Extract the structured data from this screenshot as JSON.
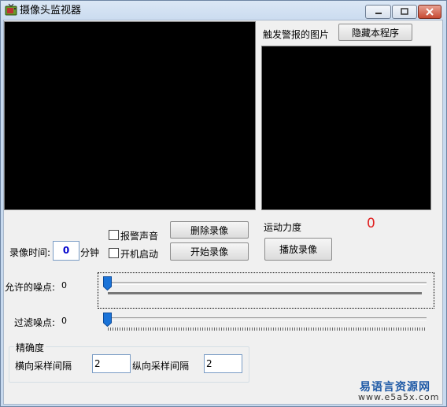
{
  "window": {
    "title": "摄像头监视器",
    "controls": {
      "minimize": "–",
      "maximize": "□",
      "close": "×"
    }
  },
  "alarm_panel": {
    "label": "触发警报的图片",
    "hide_button": "隐藏本程序"
  },
  "recording": {
    "time_label": "录像时间:",
    "time_value": "0",
    "time_unit": "分钟",
    "alarm_sound_label": "报警声音",
    "alarm_sound_checked": false,
    "autostart_label": "开机启动",
    "autostart_checked": false,
    "delete_button": "删除录像",
    "start_button": "开始录像",
    "play_button": "播放录像"
  },
  "motion": {
    "label": "运动力度",
    "value": "0",
    "value_color": "#e02020"
  },
  "sliders": {
    "noise": {
      "label": "允许的噪点:",
      "value": "0",
      "level": 0
    },
    "filter": {
      "label": "过滤噪点:",
      "value": "0",
      "level": 0
    }
  },
  "precision": {
    "group_label": "精确度",
    "horizontal_label": "横向采样间隔",
    "horizontal_value": "2",
    "vertical_label": "纵向采样间隔",
    "vertical_value": "2"
  },
  "watermark": {
    "cn": "易语言资源网",
    "url": "www.e5a5x.com"
  },
  "colors": {
    "accent_thumb": "#1a73d8",
    "video_bg": "#000000"
  }
}
